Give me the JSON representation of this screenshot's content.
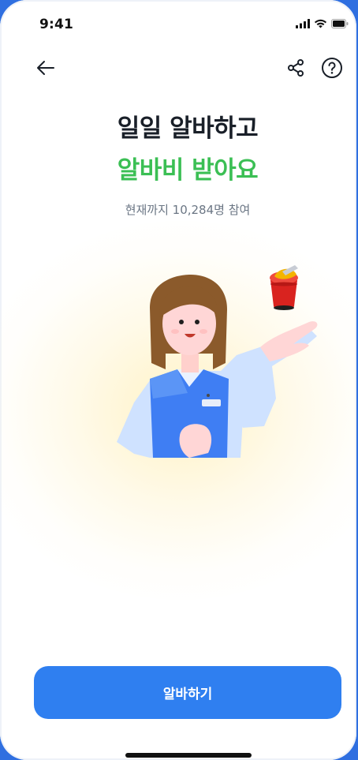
{
  "status_bar": {
    "time": "9:41"
  },
  "nav": {
    "back_icon": "arrow-left-icon",
    "share_icon": "share-icon",
    "help_icon": "help-circle-icon"
  },
  "hero": {
    "title_line1": "일일 알바하고",
    "title_line2": "알바비 받아요",
    "participants": "현재까지 10,284명 참여"
  },
  "illustration": {
    "subject": "store clerk holding cup noodles"
  },
  "cta": {
    "label": "알바하기"
  },
  "colors": {
    "accent_green": "#3bbf54",
    "primary_blue": "#2f7ff0",
    "title_dark": "#191f28",
    "subtitle_gray": "#6b7684"
  }
}
